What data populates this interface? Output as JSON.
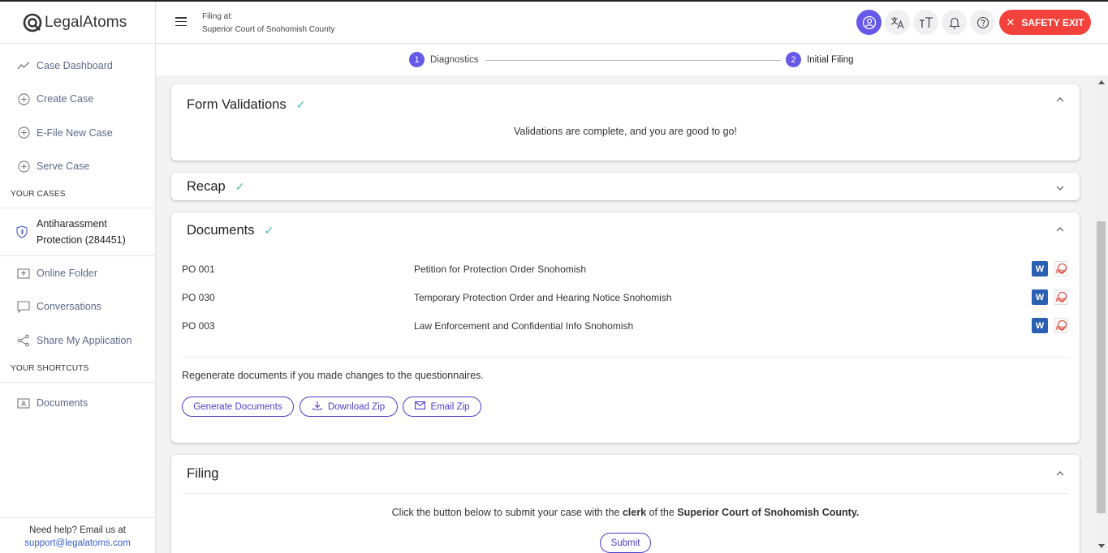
{
  "sidebar": {
    "logo_text": "LegalAtoms",
    "nav": [
      {
        "label": "Case Dashboard",
        "icon": "chart-line-icon"
      },
      {
        "label": "Create Case",
        "icon": "plus-circle-icon"
      },
      {
        "label": "E-File New Case",
        "icon": "plus-circle-icon"
      },
      {
        "label": "Serve Case",
        "icon": "plus-circle-icon"
      }
    ],
    "your_cases_label": "YOUR CASES",
    "case_line1": "Antiharassment",
    "case_line2": "Protection (284451)",
    "nav2": [
      {
        "label": "Online Folder",
        "icon": "folder-upload-icon"
      },
      {
        "label": "Conversations",
        "icon": "chat-icon"
      },
      {
        "label": "Share My Application",
        "icon": "share-icon"
      }
    ],
    "shortcuts_label": "YOUR SHORTCUTS",
    "shortcut_documents": "Documents",
    "help_text": "Need help? Email us at",
    "help_email": "support@legalatoms.com"
  },
  "header": {
    "filing_at_label": "Filing at:",
    "court": "Superior Court of Snohomish County",
    "safety_exit": "SAFETY EXIT"
  },
  "stepper": {
    "step1_num": "1",
    "step1_label": "Diagnostics",
    "step2_num": "2",
    "step2_label": "Initial Filing"
  },
  "form_validations": {
    "title": "Form Validations",
    "message": "Validations are complete, and you are good to go!"
  },
  "recap": {
    "title": "Recap"
  },
  "documents": {
    "title": "Documents",
    "rows": [
      {
        "code": "PO 001",
        "title": "Petition for Protection Order Snohomish"
      },
      {
        "code": "PO 030",
        "title": "Temporary Protection Order and Hearing Notice Snohomish"
      },
      {
        "code": "PO 003",
        "title": "Law Enforcement and Confidential Info Snohomish"
      }
    ],
    "word_icon_text": "W",
    "pdf_icon_text": "PDF",
    "regen_note": "Regenerate documents if you made changes to the questionnaires.",
    "generate_btn": "Generate Documents",
    "download_btn": "Download Zip",
    "email_btn": "Email Zip"
  },
  "filing": {
    "title": "Filing",
    "msg_pre": "Click the button below to submit your case with the ",
    "msg_clerk": "clerk",
    "msg_mid": " of the ",
    "msg_court": "Superior Court of Snohomish County.",
    "submit": "Submit"
  },
  "colors": {
    "accent": "#6659e8",
    "safety": "#f3423b",
    "check": "#55b8b0",
    "link": "#4a3fc9"
  }
}
